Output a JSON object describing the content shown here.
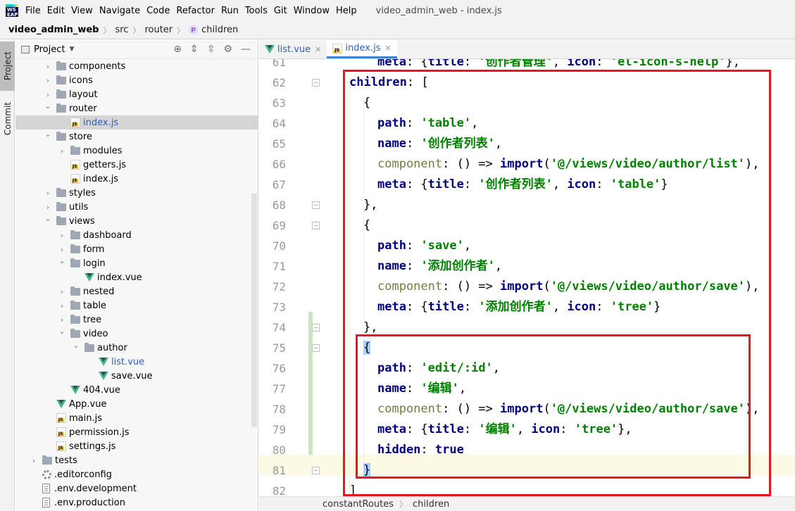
{
  "menubar": {
    "logo_text": "WS EAP",
    "items": [
      "File",
      "Edit",
      "View",
      "Navigate",
      "Code",
      "Refactor",
      "Run",
      "Tools",
      "Git",
      "Window",
      "Help"
    ],
    "window_title": "video_admin_web - index.js"
  },
  "breadcrumb": {
    "project": "video_admin_web",
    "src": "src",
    "router": "router",
    "badge": "p",
    "children": "children"
  },
  "toolstrip": {
    "project_tab": "Project",
    "commit_tab": "Commit"
  },
  "project_panel": {
    "title": "Project",
    "tree": [
      {
        "label": "components",
        "type": "folder",
        "level": 2,
        "expand": "closed"
      },
      {
        "label": "icons",
        "type": "folder",
        "level": 2,
        "expand": "closed"
      },
      {
        "label": "layout",
        "type": "folder",
        "level": 2,
        "expand": "closed"
      },
      {
        "label": "router",
        "type": "folder",
        "level": 2,
        "expand": "open"
      },
      {
        "label": "index.js",
        "type": "js",
        "level": 3,
        "expand": "none",
        "selected": true,
        "blue": true
      },
      {
        "label": "store",
        "type": "folder",
        "level": 2,
        "expand": "open"
      },
      {
        "label": "modules",
        "type": "folder",
        "level": 3,
        "expand": "closed"
      },
      {
        "label": "getters.js",
        "type": "js",
        "level": 3,
        "expand": "none"
      },
      {
        "label": "index.js",
        "type": "js",
        "level": 3,
        "expand": "none"
      },
      {
        "label": "styles",
        "type": "folder",
        "level": 2,
        "expand": "closed"
      },
      {
        "label": "utils",
        "type": "folder",
        "level": 2,
        "expand": "closed"
      },
      {
        "label": "views",
        "type": "folder",
        "level": 2,
        "expand": "open"
      },
      {
        "label": "dashboard",
        "type": "folder",
        "level": 3,
        "expand": "closed"
      },
      {
        "label": "form",
        "type": "folder",
        "level": 3,
        "expand": "closed"
      },
      {
        "label": "login",
        "type": "folder",
        "level": 3,
        "expand": "open"
      },
      {
        "label": "index.vue",
        "type": "vue",
        "level": 4,
        "expand": "none"
      },
      {
        "label": "nested",
        "type": "folder",
        "level": 3,
        "expand": "closed"
      },
      {
        "label": "table",
        "type": "folder",
        "level": 3,
        "expand": "closed"
      },
      {
        "label": "tree",
        "type": "folder",
        "level": 3,
        "expand": "closed"
      },
      {
        "label": "video",
        "type": "folder",
        "level": 3,
        "expand": "open"
      },
      {
        "label": "author",
        "type": "folder",
        "level": 4,
        "expand": "open"
      },
      {
        "label": "list.vue",
        "type": "vue",
        "level": 5,
        "expand": "none",
        "blue": true
      },
      {
        "label": "save.vue",
        "type": "vue",
        "level": 5,
        "expand": "none"
      },
      {
        "label": "404.vue",
        "type": "vue",
        "level": 3,
        "expand": "none"
      },
      {
        "label": "App.vue",
        "type": "vue",
        "level": 2,
        "expand": "none"
      },
      {
        "label": "main.js",
        "type": "js",
        "level": 2,
        "expand": "none"
      },
      {
        "label": "permission.js",
        "type": "js",
        "level": 2,
        "expand": "none"
      },
      {
        "label": "settings.js",
        "type": "js",
        "level": 2,
        "expand": "none"
      },
      {
        "label": "tests",
        "type": "folder",
        "level": 1,
        "expand": "closed"
      },
      {
        "label": ".editorconfig",
        "type": "gear",
        "level": 1,
        "expand": "none"
      },
      {
        "label": ".env.development",
        "type": "plain",
        "level": 1,
        "expand": "none"
      },
      {
        "label": ".env.production",
        "type": "plain",
        "level": 1,
        "expand": "none"
      }
    ]
  },
  "editor_tabs": [
    {
      "label": "list.vue",
      "icon": "vue",
      "active": false
    },
    {
      "label": "index.js",
      "icon": "js",
      "active": true
    }
  ],
  "editor": {
    "top_partial": "meta: {title: '创作者管理', icon: 'el-icon-s-help'},",
    "lines": [
      {
        "n": "61",
        "indent": 2,
        "tokens": [
          [
            "kw",
            "meta"
          ],
          [
            "p",
            ": {"
          ],
          [
            "kw",
            "title"
          ],
          [
            "p",
            ": "
          ],
          [
            "str",
            "'创作者管理'"
          ],
          [
            "p",
            ", "
          ],
          [
            "kw",
            "icon"
          ],
          [
            "p",
            ": "
          ],
          [
            "str",
            "'el-icon-s-help'"
          ],
          [
            "p",
            "},"
          ]
        ]
      },
      {
        "n": "62",
        "indent": 0,
        "tokens": [
          [
            "kw",
            "children"
          ],
          [
            "p",
            ": ["
          ]
        ]
      },
      {
        "n": "63",
        "indent": 1,
        "tokens": [
          [
            "p",
            "{"
          ]
        ]
      },
      {
        "n": "64",
        "indent": 2,
        "tokens": [
          [
            "kw",
            "path"
          ],
          [
            "p",
            ": "
          ],
          [
            "str",
            "'table'"
          ],
          [
            "p",
            ","
          ]
        ]
      },
      {
        "n": "65",
        "indent": 2,
        "tokens": [
          [
            "kw",
            "name"
          ],
          [
            "p",
            ": "
          ],
          [
            "str",
            "'创作者列表'"
          ],
          [
            "p",
            ","
          ]
        ]
      },
      {
        "n": "66",
        "indent": 2,
        "tokens": [
          [
            "fn",
            "component"
          ],
          [
            "p",
            ": () => "
          ],
          [
            "kw",
            "import"
          ],
          [
            "p",
            "("
          ],
          [
            "str",
            "'@/views/video/author/list'"
          ],
          [
            "p",
            "),"
          ]
        ]
      },
      {
        "n": "67",
        "indent": 2,
        "tokens": [
          [
            "kw",
            "meta"
          ],
          [
            "p",
            ": {"
          ],
          [
            "kw",
            "title"
          ],
          [
            "p",
            ": "
          ],
          [
            "str",
            "'创作者列表'"
          ],
          [
            "p",
            ", "
          ],
          [
            "kw",
            "icon"
          ],
          [
            "p",
            ": "
          ],
          [
            "str",
            "'table'"
          ],
          [
            "p",
            "}"
          ]
        ]
      },
      {
        "n": "68",
        "indent": 1,
        "tokens": [
          [
            "p",
            "},"
          ]
        ]
      },
      {
        "n": "69",
        "indent": 1,
        "tokens": [
          [
            "p",
            "{"
          ]
        ]
      },
      {
        "n": "70",
        "indent": 2,
        "tokens": [
          [
            "kw",
            "path"
          ],
          [
            "p",
            ": "
          ],
          [
            "str",
            "'save'"
          ],
          [
            "p",
            ","
          ]
        ]
      },
      {
        "n": "71",
        "indent": 2,
        "tokens": [
          [
            "kw",
            "name"
          ],
          [
            "p",
            ": "
          ],
          [
            "str",
            "'添加创作者'"
          ],
          [
            "p",
            ","
          ]
        ]
      },
      {
        "n": "72",
        "indent": 2,
        "tokens": [
          [
            "fn",
            "component"
          ],
          [
            "p",
            ": () => "
          ],
          [
            "kw",
            "import"
          ],
          [
            "p",
            "("
          ],
          [
            "str",
            "'@/views/video/author/save'"
          ],
          [
            "p",
            "),"
          ]
        ]
      },
      {
        "n": "73",
        "indent": 2,
        "tokens": [
          [
            "kw",
            "meta"
          ],
          [
            "p",
            ": {"
          ],
          [
            "kw",
            "title"
          ],
          [
            "p",
            ": "
          ],
          [
            "str",
            "'添加创作者'"
          ],
          [
            "p",
            ", "
          ],
          [
            "kw",
            "icon"
          ],
          [
            "p",
            ": "
          ],
          [
            "str",
            "'tree'"
          ],
          [
            "p",
            "}"
          ]
        ]
      },
      {
        "n": "74",
        "indent": 1,
        "tokens": [
          [
            "p",
            "},"
          ]
        ]
      },
      {
        "n": "75",
        "indent": 1,
        "tokens": [
          [
            "match",
            "{"
          ]
        ]
      },
      {
        "n": "76",
        "indent": 2,
        "tokens": [
          [
            "kw",
            "path"
          ],
          [
            "p",
            ": "
          ],
          [
            "str",
            "'edit/:id'"
          ],
          [
            "p",
            ","
          ]
        ]
      },
      {
        "n": "77",
        "indent": 2,
        "tokens": [
          [
            "kw",
            "name"
          ],
          [
            "p",
            ": "
          ],
          [
            "str",
            "'编辑'"
          ],
          [
            "p",
            ","
          ]
        ]
      },
      {
        "n": "78",
        "indent": 2,
        "tokens": [
          [
            "fn",
            "component"
          ],
          [
            "p",
            ": () => "
          ],
          [
            "kw",
            "import"
          ],
          [
            "p",
            "("
          ],
          [
            "str",
            "'@/views/video/author/save'"
          ],
          [
            "p",
            "),"
          ]
        ]
      },
      {
        "n": "79",
        "indent": 2,
        "tokens": [
          [
            "kw",
            "meta"
          ],
          [
            "p",
            ": {"
          ],
          [
            "kw",
            "title"
          ],
          [
            "p",
            ": "
          ],
          [
            "str",
            "'编辑'"
          ],
          [
            "p",
            ", "
          ],
          [
            "kw",
            "icon"
          ],
          [
            "p",
            ": "
          ],
          [
            "str",
            "'tree'"
          ],
          [
            "p",
            "},"
          ]
        ]
      },
      {
        "n": "80",
        "indent": 2,
        "tokens": [
          [
            "kw",
            "hidden"
          ],
          [
            "p",
            ": "
          ],
          [
            "kw",
            "true"
          ]
        ]
      },
      {
        "n": "81",
        "indent": 1,
        "tokens": [
          [
            "match",
            "}"
          ]
        ]
      },
      {
        "n": "82",
        "indent": 0,
        "tokens": [
          [
            "p",
            "]"
          ]
        ]
      }
    ]
  },
  "statusbar": {
    "left": "constantRoutes",
    "right": "children"
  },
  "colors": {
    "annotation_red": "#e3191e",
    "keyword": "#000080",
    "string": "#008000",
    "accent": "#4083c9"
  }
}
